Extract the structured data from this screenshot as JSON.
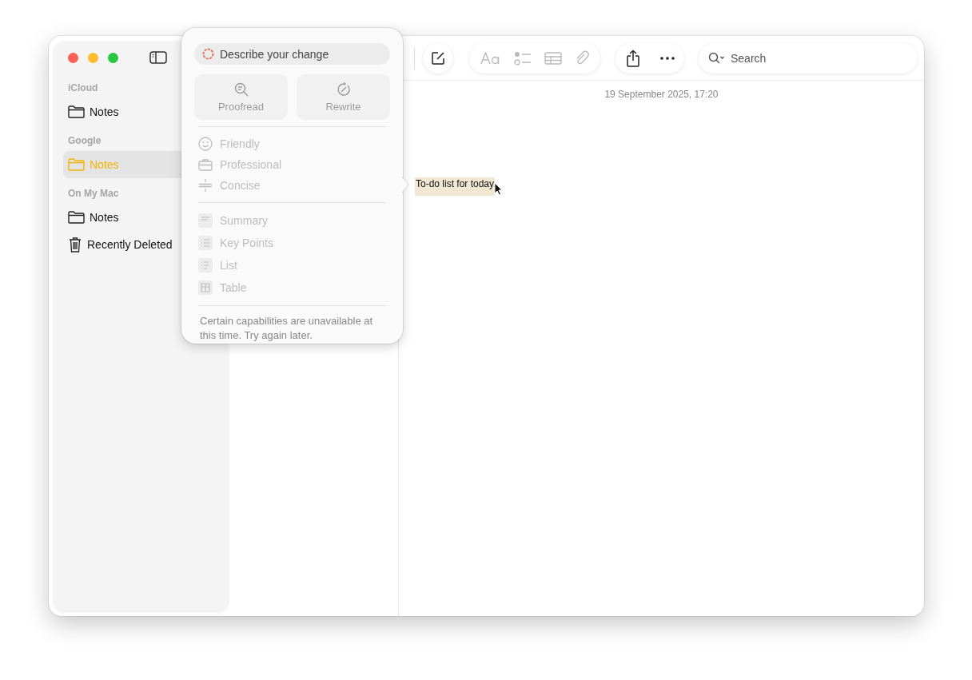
{
  "sidebar": {
    "sections": [
      {
        "title": "iCloud",
        "items": [
          {
            "label": "Notes",
            "kind": "folder",
            "selected": false
          }
        ]
      },
      {
        "title": "Google",
        "items": [
          {
            "label": "Notes",
            "kind": "folder",
            "selected": true
          }
        ]
      },
      {
        "title": "On My Mac",
        "items": [
          {
            "label": "Notes",
            "kind": "folder",
            "selected": false
          },
          {
            "label": "Recently Deleted",
            "kind": "trash",
            "selected": false
          }
        ]
      }
    ]
  },
  "toolbar": {
    "search": {
      "placeholder": "Search"
    }
  },
  "editor": {
    "date": "19 September 2025, 17:20",
    "text": "To-do list for today",
    "selected": true
  },
  "writing_tools": {
    "prompt": {
      "placeholder": "Describe your change"
    },
    "actions": [
      {
        "label": "Proofread",
        "kind": "proofread",
        "disabled": true
      },
      {
        "label": "Rewrite",
        "kind": "rewrite",
        "disabled": true
      }
    ],
    "tones": [
      {
        "label": "Friendly",
        "kind": "friendly",
        "disabled": true
      },
      {
        "label": "Professional",
        "kind": "professional",
        "disabled": true
      },
      {
        "label": "Concise",
        "kind": "concise",
        "disabled": true
      }
    ],
    "formats": [
      {
        "label": "Summary",
        "kind": "summary",
        "disabled": true
      },
      {
        "label": "Key Points",
        "kind": "keypoints",
        "disabled": true
      },
      {
        "label": "List",
        "kind": "list",
        "disabled": true
      },
      {
        "label": "Table",
        "kind": "table",
        "disabled": true
      }
    ],
    "note": "Certain capabilities are unavailable at this time. Try again later."
  }
}
